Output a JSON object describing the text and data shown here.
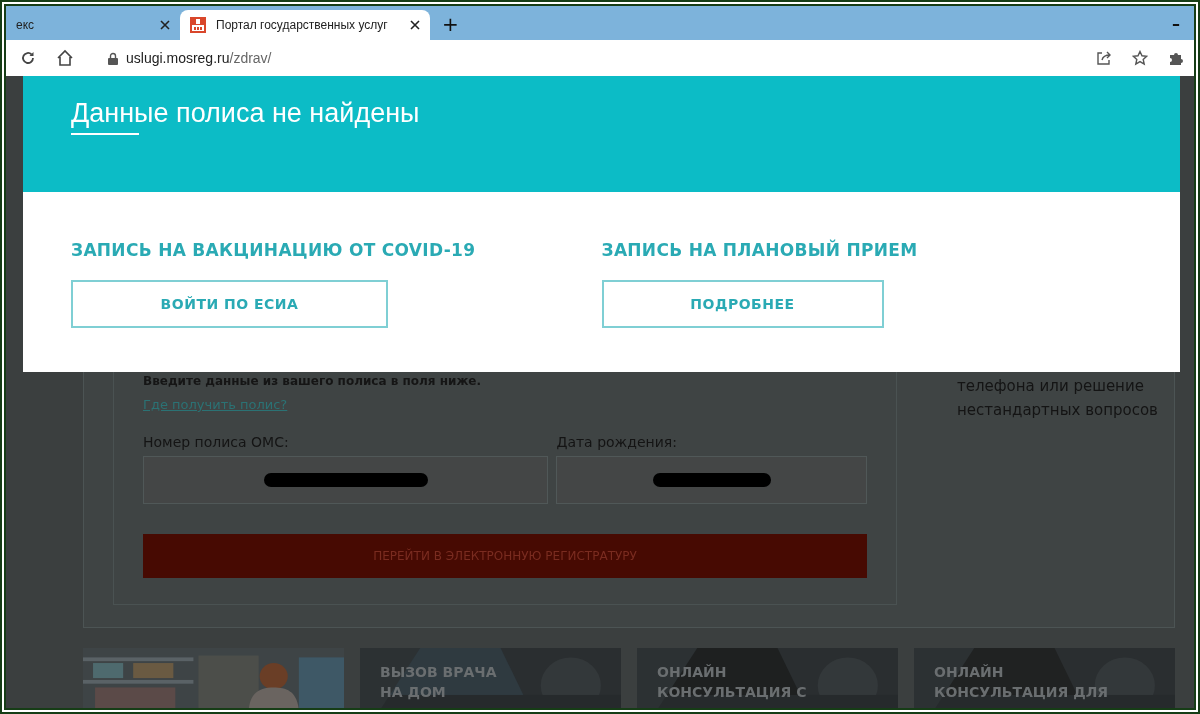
{
  "browser": {
    "tabs": [
      {
        "title": "екс",
        "selected": false
      },
      {
        "title": "Портал государственных услуг",
        "selected": true
      }
    ],
    "new_tab": "+",
    "minimize": "–",
    "address": {
      "host": "uslugi.mosreg.ru",
      "path": "/zdrav/"
    }
  },
  "modal": {
    "title": "Данные полиса не найдены",
    "sections": [
      {
        "heading": "ЗАПИСЬ НА ВАКЦИНАЦИЮ ОТ COVID-19",
        "button": "ВОЙТИ ПО ЕСИА"
      },
      {
        "heading": "ЗАПИСЬ НА ПЛАНОВЫЙ ПРИЕМ",
        "button": "ПОДРОБНЕЕ"
      }
    ]
  },
  "page": {
    "instruction": "Введите данные из вашего полиса в поля ниже.",
    "help_link": "Где получить полис?",
    "fields": [
      {
        "label": "Номер полиса ОМС:",
        "redacted": true
      },
      {
        "label": "Дата рождения:",
        "redacted": true
      }
    ],
    "submit": "ПЕРЕЙТИ В ЭЛЕКТРОННУЮ РЕГИСТРАТУРУ",
    "side_text": "телефона или решение нестандартных вопросов",
    "cards": [
      {
        "kind": "picture"
      },
      {
        "kind": "service",
        "title": "ВЫЗОВ ВРАЧА НА ДОМ"
      },
      {
        "kind": "service",
        "title": "ОНЛАЙН КОНСУЛЬТАЦИЯ С"
      },
      {
        "kind": "service",
        "title": "ОНЛАЙН КОНСУЛЬТАЦИЯ ДЛЯ"
      }
    ]
  }
}
